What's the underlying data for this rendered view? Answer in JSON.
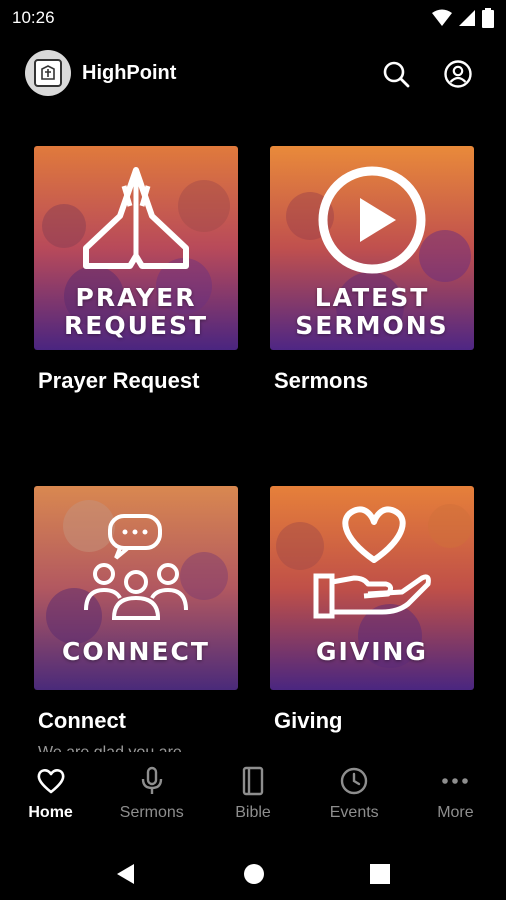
{
  "status_bar": {
    "time": "10:26",
    "icons": [
      "wifi-icon",
      "signal-icon",
      "battery-icon"
    ]
  },
  "app_bar": {
    "title": "HighPoint",
    "icons": [
      "search-icon",
      "account-icon"
    ]
  },
  "tiles": [
    {
      "image_text_1": "PRAYER",
      "image_text_2": "REQUEST",
      "title": "Prayer Request",
      "icon": "praying-hands-icon"
    },
    {
      "image_text_1": "LATEST",
      "image_text_2": "SERMONS",
      "title": "Sermons",
      "icon": "play-icon"
    },
    {
      "image_text_1": "CONNECT",
      "image_text_2": "",
      "title": "Connect",
      "subtitle": "We are glad you are",
      "icon": "people-chat-icon"
    },
    {
      "image_text_1": "GIVING",
      "image_text_2": "",
      "title": "Giving",
      "icon": "heart-hand-icon"
    }
  ],
  "bottom_nav": {
    "items": [
      {
        "label": "Home",
        "icon": "heart-icon",
        "active": true
      },
      {
        "label": "Sermons",
        "icon": "microphone-icon"
      },
      {
        "label": "Bible",
        "icon": "book-icon"
      },
      {
        "label": "Events",
        "icon": "clock-icon"
      },
      {
        "label": "More",
        "icon": "more-dots-icon"
      }
    ]
  },
  "colors": {
    "background": "#000000",
    "text": "#ffffff",
    "inactive": "#8e8e8e",
    "tile_orange": "#e8893a",
    "tile_purple": "#5b2a8c"
  }
}
